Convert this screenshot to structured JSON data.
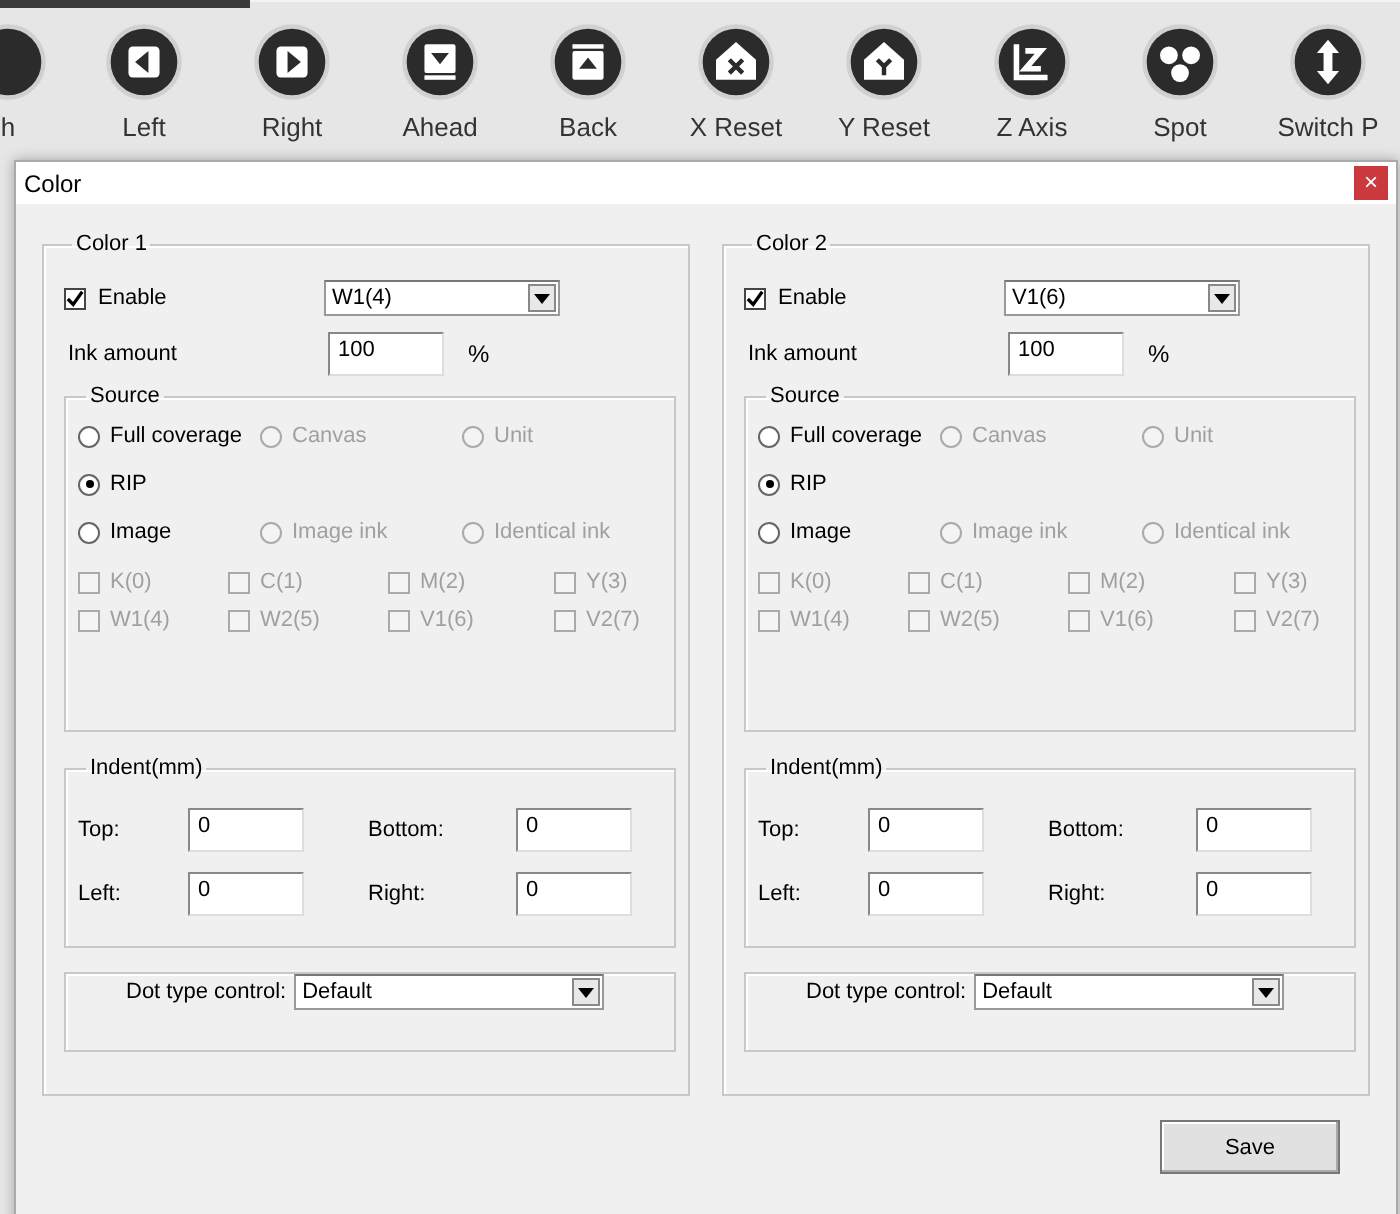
{
  "toolbar": {
    "items": [
      {
        "label": "h"
      },
      {
        "label": "Left"
      },
      {
        "label": "Right"
      },
      {
        "label": "Ahead"
      },
      {
        "label": "Back"
      },
      {
        "label": "X Reset"
      },
      {
        "label": "Y Reset"
      },
      {
        "label": "Z Axis"
      },
      {
        "label": "Spot"
      },
      {
        "label": "Switch P"
      }
    ]
  },
  "dialog": {
    "title": "Color",
    "close": "×",
    "groups": [
      {
        "title": "Color 1",
        "enable": {
          "label": "Enable",
          "checked": true
        },
        "channel": "W1(4)",
        "ink": {
          "label": "Ink amount",
          "value": "100",
          "unit": "%"
        },
        "source": {
          "title": "Source",
          "options": [
            {
              "label": "Full coverage",
              "selected": false,
              "disabled": false
            },
            {
              "label": "Canvas",
              "selected": false,
              "disabled": true
            },
            {
              "label": "Unit",
              "selected": false,
              "disabled": true
            },
            {
              "label": "RIP",
              "selected": true,
              "disabled": false
            },
            {
              "label": "Image",
              "selected": false,
              "disabled": false
            },
            {
              "label": "Image ink",
              "selected": false,
              "disabled": true
            },
            {
              "label": "Identical ink",
              "selected": false,
              "disabled": true
            }
          ],
          "inks": [
            {
              "label": "K(0)",
              "checked": false,
              "disabled": true
            },
            {
              "label": "C(1)",
              "checked": false,
              "disabled": true
            },
            {
              "label": "M(2)",
              "checked": false,
              "disabled": true
            },
            {
              "label": "Y(3)",
              "checked": false,
              "disabled": true
            },
            {
              "label": "W1(4)",
              "checked": false,
              "disabled": true
            },
            {
              "label": "W2(5)",
              "checked": false,
              "disabled": true
            },
            {
              "label": "V1(6)",
              "checked": false,
              "disabled": true
            },
            {
              "label": "V2(7)",
              "checked": false,
              "disabled": true
            }
          ]
        },
        "indent": {
          "title": "Indent(mm)",
          "fields": [
            {
              "label": "Top:",
              "value": "0"
            },
            {
              "label": "Bottom:",
              "value": "0"
            },
            {
              "label": "Left:",
              "value": "0"
            },
            {
              "label": "Right:",
              "value": "0"
            }
          ]
        },
        "dot": {
          "label": "Dot type control:",
          "value": "Default"
        }
      },
      {
        "title": "Color 2",
        "enable": {
          "label": "Enable",
          "checked": true
        },
        "channel": "V1(6)",
        "ink": {
          "label": "Ink amount",
          "value": "100",
          "unit": "%"
        },
        "source": {
          "title": "Source",
          "options": [
            {
              "label": "Full coverage",
              "selected": false,
              "disabled": false
            },
            {
              "label": "Canvas",
              "selected": false,
              "disabled": true
            },
            {
              "label": "Unit",
              "selected": false,
              "disabled": true
            },
            {
              "label": "RIP",
              "selected": true,
              "disabled": false
            },
            {
              "label": "Image",
              "selected": false,
              "disabled": false
            },
            {
              "label": "Image ink",
              "selected": false,
              "disabled": true
            },
            {
              "label": "Identical ink",
              "selected": false,
              "disabled": true
            }
          ],
          "inks": [
            {
              "label": "K(0)",
              "checked": false,
              "disabled": true
            },
            {
              "label": "C(1)",
              "checked": false,
              "disabled": true
            },
            {
              "label": "M(2)",
              "checked": false,
              "disabled": true
            },
            {
              "label": "Y(3)",
              "checked": false,
              "disabled": true
            },
            {
              "label": "W1(4)",
              "checked": false,
              "disabled": true
            },
            {
              "label": "W2(5)",
              "checked": false,
              "disabled": true
            },
            {
              "label": "V1(6)",
              "checked": false,
              "disabled": true
            },
            {
              "label": "V2(7)",
              "checked": false,
              "disabled": true
            }
          ]
        },
        "indent": {
          "title": "Indent(mm)",
          "fields": [
            {
              "label": "Top:",
              "value": "0"
            },
            {
              "label": "Bottom:",
              "value": "0"
            },
            {
              "label": "Left:",
              "value": "0"
            },
            {
              "label": "Right:",
              "value": "0"
            }
          ]
        },
        "dot": {
          "label": "Dot type control:",
          "value": "Default"
        }
      }
    ],
    "save": "Save"
  }
}
